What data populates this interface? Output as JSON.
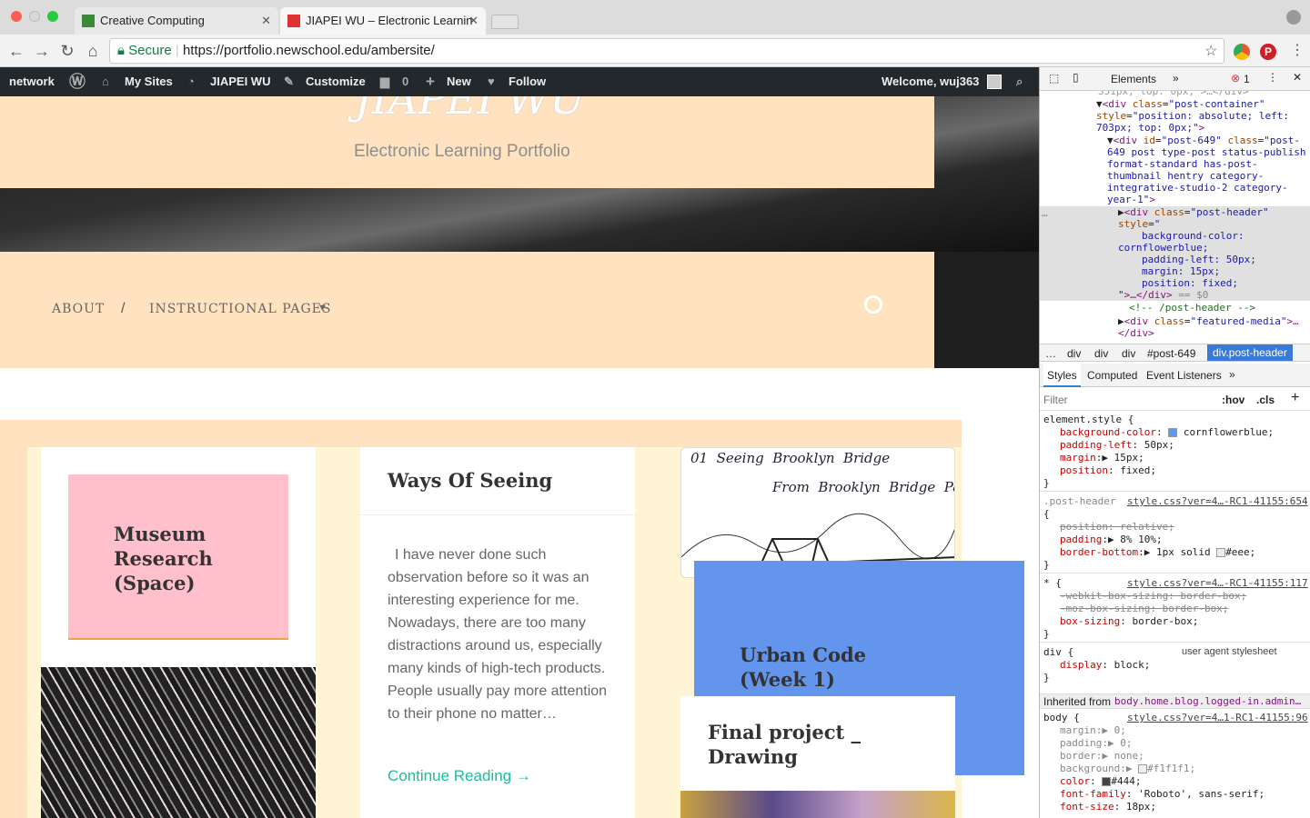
{
  "browser": {
    "tabs": [
      {
        "title": "Creative Computing",
        "favicon_color": "#3a8a3a"
      },
      {
        "title": "JIAPEI WU – Electronic Learnin",
        "favicon_color": "#d33"
      }
    ],
    "secure_label": "Secure",
    "url": "https://portfolio.newschool.edu/ambersite/"
  },
  "adminbar": {
    "network": "network",
    "my_sites": "My Sites",
    "site_name": "JIAPEI WU",
    "customize": "Customize",
    "comments_count": "0",
    "new": "New",
    "follow": "Follow",
    "welcome": "Welcome, wuj363"
  },
  "site": {
    "title": "JIAPEI WU",
    "tagline": "Electronic Learning Portfolio",
    "menu": {
      "about": "ABOUT",
      "separator": "/",
      "instructional": "INSTRUCTIONAL PAGES"
    }
  },
  "posts": {
    "museum": {
      "title": "Museum Research (Space)"
    },
    "ways": {
      "title": "Ways Of Seeing",
      "excerpt": "I have never done such observation before so it was an interesting experience for me. Nowadays, there are too many distractions around us, especially many kinds of high-tech products. People usually pay more attention to their phone no matter…",
      "continue": "Continue Reading →"
    },
    "bridge": {
      "line1": "01  Seeing  Brooklyn  Bridge",
      "line2": "From  Brooklyn  Bridge  Park"
    },
    "urban": {
      "title": "Urban Code (Week 1)"
    },
    "final": {
      "title": "Final project _ Drawing"
    }
  },
  "devtools": {
    "tabs": {
      "elements": "Elements",
      "more": "»",
      "errors": "1"
    },
    "breadcrumbs": [
      "…",
      "div",
      "div",
      "div",
      "#post-649",
      "div.post-header"
    ],
    "panel_tabs": [
      "Styles",
      "Computed",
      "Event Listeners",
      "»"
    ],
    "filter_placeholder": "Filter",
    "hov": ":hov",
    "cls": ".cls",
    "inherited_label": "Inherited from",
    "inherited_from": "body.home.blog.logged-in.admin…",
    "rule_sources": {
      "post_header": "style.css?ver=4…-RC1-41155:654",
      "star": "style.css?ver=4…-RC1-41155:117",
      "ua": "user agent stylesheet",
      "body": "style.css?ver=4…1-RC1-41155:96"
    },
    "colors": {
      "cornflowerblue": "#6495ed",
      "eee": "#eeeeee",
      "f1": "#f1f1f1",
      "c444": "#444444"
    }
  }
}
